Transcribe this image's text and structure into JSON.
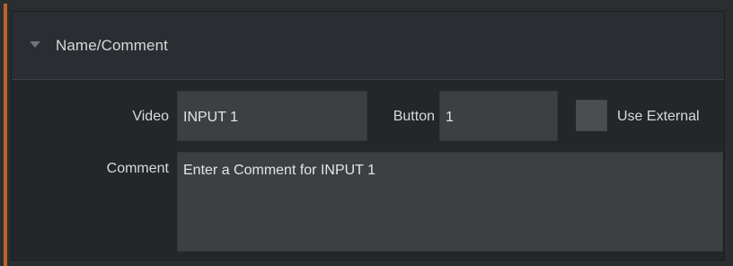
{
  "section": {
    "title": "Name/Comment",
    "icon": "chevron-down-icon"
  },
  "fields": {
    "video_label": "Video",
    "video_value": "INPUT 1",
    "button_label": "Button",
    "button_value": "1",
    "use_external_label": "Use External",
    "use_external_checked": false,
    "comment_label": "Comment",
    "comment_value": "Enter a Comment for INPUT 1"
  },
  "colors": {
    "accent": "#c0622a",
    "field_bg": "#3c4043",
    "panel_bg": "#24272a",
    "text": "#d7dadc"
  }
}
